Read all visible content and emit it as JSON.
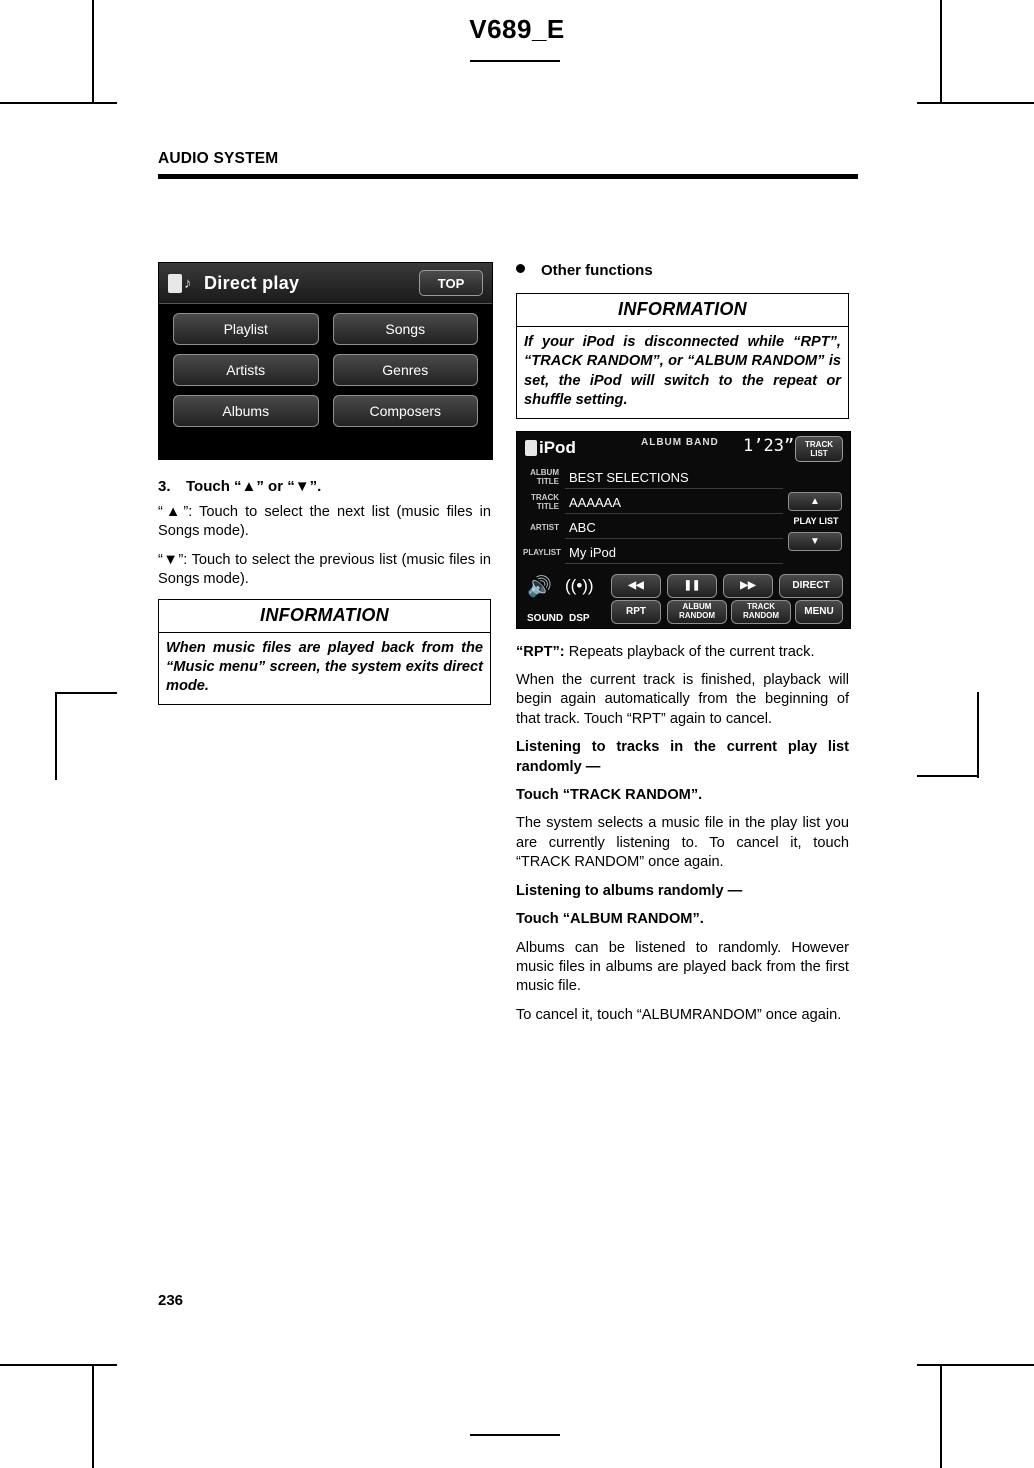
{
  "document": {
    "code": "V689_E",
    "section_title": "AUDIO SYSTEM",
    "page_number": "236"
  },
  "left_column": {
    "direct_play_screen": {
      "title": "Direct play",
      "top_button": "TOP",
      "buttons": [
        "Playlist",
        "Songs",
        "Artists",
        "Genres",
        "Albums",
        "Composers"
      ]
    },
    "step": {
      "number": "3.",
      "text": "Touch “▲” or “▼”."
    },
    "paragraphs": [
      "“▲”: Touch to select the next list (music files in Songs mode).",
      "“▼”: Touch to select the previous list (music files in Songs mode)."
    ],
    "information": {
      "title": "INFORMATION",
      "body": "When music files are played back from the “Music menu” screen, the system exits direct mode."
    }
  },
  "right_column": {
    "bullet_heading": "Other functions",
    "information": {
      "title": "INFORMATION",
      "body": "If your iPod is disconnected while “RPT”, “TRACK RANDOM”, or “ALBUM RANDOM” is set, the iPod will switch to the repeat or shuffle setting."
    },
    "ipod_screen": {
      "logo": "iPod",
      "album_band": "ALBUM  BAND",
      "time": "1’23”",
      "track_list_button": "TRACK LIST",
      "rows": [
        {
          "tag": "ALBUM TITLE",
          "value": "BEST SELECTIONS"
        },
        {
          "tag": "TRACK TITLE",
          "value": "AAAAAA"
        },
        {
          "tag": "ARTIST",
          "value": "ABC"
        },
        {
          "tag": "PLAYLIST",
          "value": "My iPod"
        }
      ],
      "up_arrow": "▲",
      "down_arrow": "▼",
      "play_list_label": "PLAY LIST",
      "controls": {
        "sound": "SOUND",
        "dsp": "DSP",
        "rpt": "RPT",
        "rewind": "◀◀",
        "pause": "❚❚",
        "forward": "▶▶",
        "album_random": "ALBUM RANDOM",
        "track_random": "TRACK RANDOM",
        "direct": "DIRECT",
        "menu": "MENU"
      }
    },
    "body": [
      {
        "lead": "“RPT”:",
        "text": " Repeats playback of the current track."
      },
      {
        "lead": "",
        "text": "When the current track is finished, playback will begin again automatically from the beginning of that track. Touch “RPT” again to cancel.",
        "bold_tail": "“RPT”"
      },
      {
        "lead": "",
        "text": "Listening to tracks in the current play list randomly —",
        "style": "bold"
      },
      {
        "lead": "",
        "text": "Touch “TRACK RANDOM”.",
        "style": "bold"
      },
      {
        "lead": "",
        "text": "The system selects a music file in the play list you are currently listening to. To cancel it, touch “TRACK RANDOM” once again."
      },
      {
        "lead": "",
        "text": "Listening to albums randomly —",
        "style": "bold"
      },
      {
        "lead": "",
        "text": "Touch “ALBUM RANDOM”.",
        "style": "bold"
      },
      {
        "lead": "",
        "text": "Albums can be listened to randomly. However music files in albums are played back from the first music file."
      },
      {
        "lead": "",
        "text": "To cancel it, touch “ALBUMRANDOM” once again."
      }
    ]
  }
}
